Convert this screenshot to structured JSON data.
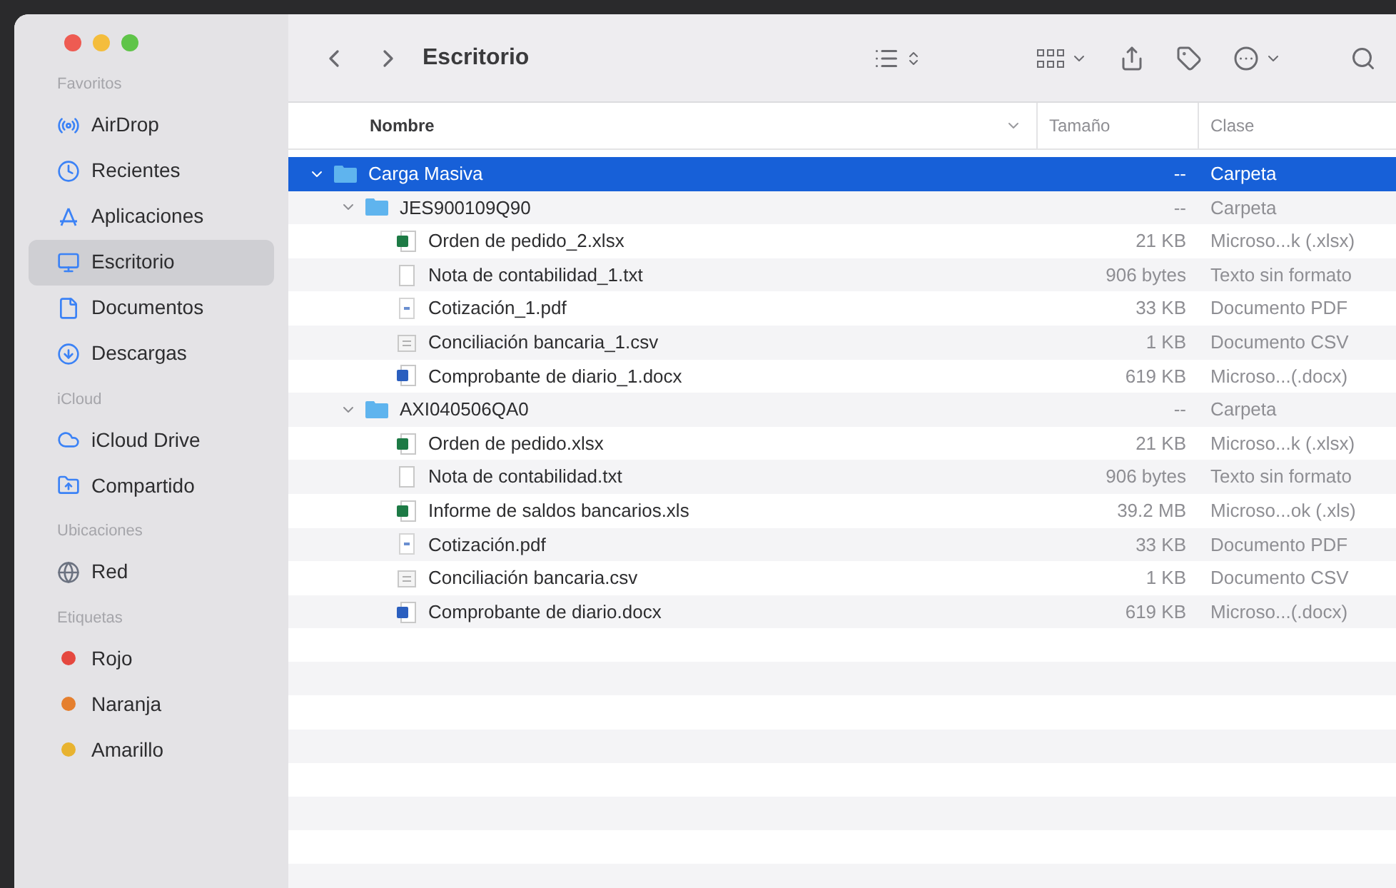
{
  "window": {
    "title": "Escritorio"
  },
  "sidebar": {
    "sections": [
      {
        "heading": "Favoritos",
        "items": [
          {
            "label": "AirDrop",
            "kind": "airdrop",
            "selected": false
          },
          {
            "label": "Recientes",
            "kind": "clock",
            "selected": false
          },
          {
            "label": "Aplicaciones",
            "kind": "apps",
            "selected": false
          },
          {
            "label": "Escritorio",
            "kind": "desktop",
            "selected": true
          },
          {
            "label": "Documentos",
            "kind": "doc",
            "selected": false
          },
          {
            "label": "Descargas",
            "kind": "download",
            "selected": false
          }
        ]
      },
      {
        "heading": "iCloud",
        "items": [
          {
            "label": "iCloud Drive",
            "kind": "cloud",
            "selected": false
          },
          {
            "label": "Compartido",
            "kind": "shared",
            "selected": false
          }
        ]
      },
      {
        "heading": "Ubicaciones",
        "items": [
          {
            "label": "Red",
            "kind": "network",
            "selected": false
          }
        ]
      },
      {
        "heading": "Etiquetas",
        "items": [
          {
            "label": "Rojo",
            "kind": "tag",
            "color": "#e5483f",
            "selected": false
          },
          {
            "label": "Naranja",
            "kind": "tag",
            "color": "#e57f2e",
            "selected": false
          },
          {
            "label": "Amarillo",
            "kind": "tag",
            "color": "#e8b330",
            "selected": false
          }
        ]
      }
    ]
  },
  "table": {
    "columns": [
      {
        "label": "Nombre",
        "sorted": true
      },
      {
        "label": "Tamaño",
        "sorted": false
      },
      {
        "label": "Clase",
        "sorted": false
      }
    ],
    "rows": [
      {
        "name": "Carga Masiva",
        "kind": "folder",
        "size": "--",
        "type": "Carpeta",
        "expanded": true,
        "selected": true,
        "children": [
          {
            "name": "JES900109Q90",
            "kind": "folder",
            "size": "--",
            "type": "Carpeta",
            "expanded": true,
            "selected": false,
            "children": [
              {
                "name": "Orden de pedido_2.xlsx",
                "kind": "excel",
                "size": "21 KB",
                "type": "Microso...k (.xlsx)",
                "selected": false
              },
              {
                "name": "Nota de contabilidad_1.txt",
                "kind": "text",
                "size": "906 bytes",
                "type": "Texto sin formato",
                "selected": false
              },
              {
                "name": "Cotización_1.pdf",
                "kind": "pdf",
                "size": "33 KB",
                "type": "Documento PDF",
                "selected": false
              },
              {
                "name": "Conciliación bancaria_1.csv",
                "kind": "csv",
                "size": "1 KB",
                "type": "Documento CSV",
                "selected": false
              },
              {
                "name": "Comprobante de diario_1.docx",
                "kind": "word",
                "size": "619 KB",
                "type": "Microso...(.docx)",
                "selected": false
              }
            ]
          },
          {
            "name": "AXI040506QA0",
            "kind": "folder",
            "size": "--",
            "type": "Carpeta",
            "expanded": true,
            "selected": false,
            "children": [
              {
                "name": "Orden de pedido.xlsx",
                "kind": "excel",
                "size": "21 KB",
                "type": "Microso...k (.xlsx)",
                "selected": false
              },
              {
                "name": "Nota de contabilidad.txt",
                "kind": "text",
                "size": "906 bytes",
                "type": "Texto sin formato",
                "selected": false
              },
              {
                "name": "Informe de saldos bancarios.xls",
                "kind": "excel",
                "size": "39.2 MB",
                "type": "Microso...ok (.xls)",
                "selected": false
              },
              {
                "name": "Cotización.pdf",
                "kind": "pdf",
                "size": "33 KB",
                "type": "Documento PDF",
                "selected": false
              },
              {
                "name": "Conciliación bancaria.csv",
                "kind": "csv",
                "size": "1 KB",
                "type": "Documento CSV",
                "selected": false
              },
              {
                "name": "Comprobante de diario.docx",
                "kind": "word",
                "size": "619 KB",
                "type": "Microso...(.docx)",
                "selected": false
              }
            ]
          }
        ]
      }
    ]
  }
}
